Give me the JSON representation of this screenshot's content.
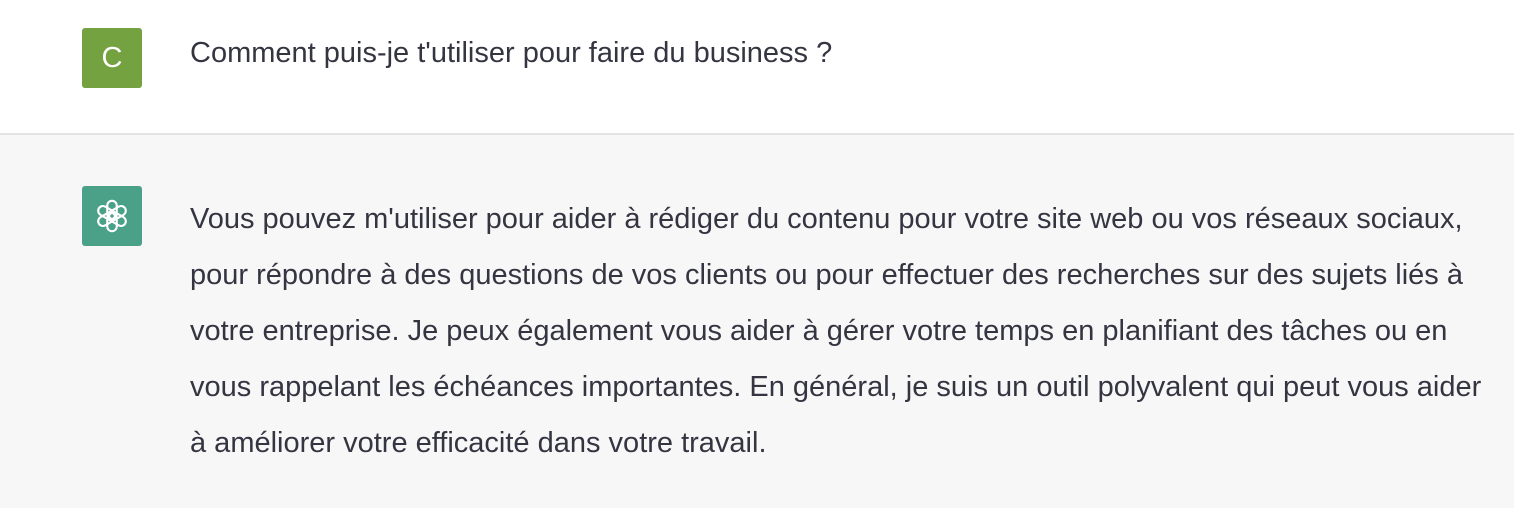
{
  "user_message": {
    "avatar_initial": "C",
    "avatar_color": "#75a241",
    "text": "Comment puis-je t'utiliser pour faire du business ?"
  },
  "assistant_message": {
    "avatar_icon": "openai-logo-icon",
    "avatar_color": "#4aa187",
    "text": "Vous pouvez m'utiliser pour aider à rédiger du contenu pour votre site web ou vos réseaux sociaux, pour répondre à des questions de vos clients ou pour effectuer des recherches sur des sujets liés à votre entreprise. Je peux également vous aider à gérer votre temps en planifiant des tâches ou en vous rappelant les échéances importantes. En général, je suis un outil polyvalent qui peut vous aider à améliorer votre efficacité dans votre travail."
  }
}
